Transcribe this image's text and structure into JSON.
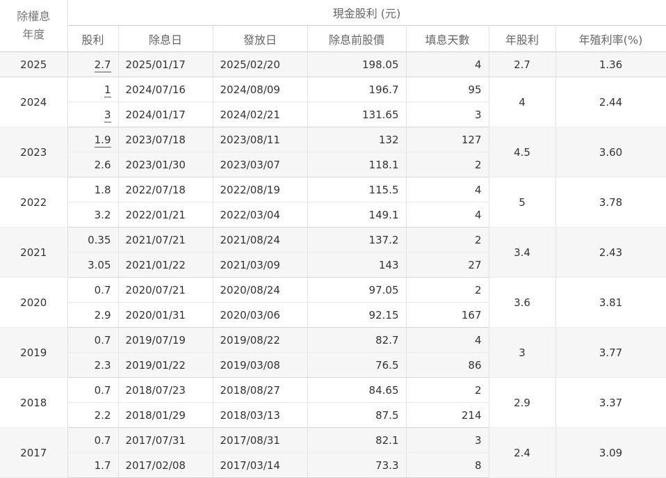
{
  "header": {
    "year_line1": "除權息",
    "year_line2": "年度",
    "group_title": "現金股利 (元)",
    "cols": [
      "股利",
      "除息日",
      "發放日",
      "除息前股價",
      "填息天數",
      "年股利",
      "年殖利率(%)"
    ]
  },
  "years": [
    {
      "year": "2025",
      "annual": "2.7",
      "yield": "1.36",
      "rows": [
        {
          "div": "2.7",
          "underline": true,
          "ex": "2025/01/17",
          "pay": "2025/02/20",
          "price": "198.05",
          "days": "4"
        }
      ]
    },
    {
      "year": "2024",
      "annual": "4",
      "yield": "2.44",
      "rows": [
        {
          "div": "1",
          "underline": true,
          "ex": "2024/07/16",
          "pay": "2024/08/09",
          "price": "196.7",
          "days": "95"
        },
        {
          "div": "3",
          "underline": true,
          "ex": "2024/01/17",
          "pay": "2024/02/21",
          "price": "131.65",
          "days": "3"
        }
      ]
    },
    {
      "year": "2023",
      "annual": "4.5",
      "yield": "3.60",
      "rows": [
        {
          "div": "1.9",
          "underline": true,
          "ex": "2023/07/18",
          "pay": "2023/08/11",
          "price": "132",
          "days": "127"
        },
        {
          "div": "2.6",
          "underline": false,
          "ex": "2023/01/30",
          "pay": "2023/03/07",
          "price": "118.1",
          "days": "2"
        }
      ]
    },
    {
      "year": "2022",
      "annual": "5",
      "yield": "3.78",
      "rows": [
        {
          "div": "1.8",
          "underline": false,
          "ex": "2022/07/18",
          "pay": "2022/08/19",
          "price": "115.5",
          "days": "4"
        },
        {
          "div": "3.2",
          "underline": false,
          "ex": "2022/01/21",
          "pay": "2022/03/04",
          "price": "149.1",
          "days": "4"
        }
      ]
    },
    {
      "year": "2021",
      "annual": "3.4",
      "yield": "2.43",
      "rows": [
        {
          "div": "0.35",
          "underline": false,
          "ex": "2021/07/21",
          "pay": "2021/08/24",
          "price": "137.2",
          "days": "2"
        },
        {
          "div": "3.05",
          "underline": false,
          "ex": "2021/01/22",
          "pay": "2021/03/09",
          "price": "143",
          "days": "27"
        }
      ]
    },
    {
      "year": "2020",
      "annual": "3.6",
      "yield": "3.81",
      "rows": [
        {
          "div": "0.7",
          "underline": false,
          "ex": "2020/07/21",
          "pay": "2020/08/24",
          "price": "97.05",
          "days": "2"
        },
        {
          "div": "2.9",
          "underline": false,
          "ex": "2020/01/31",
          "pay": "2020/03/06",
          "price": "92.15",
          "days": "167"
        }
      ]
    },
    {
      "year": "2019",
      "annual": "3",
      "yield": "3.77",
      "rows": [
        {
          "div": "0.7",
          "underline": false,
          "ex": "2019/07/19",
          "pay": "2019/08/22",
          "price": "82.7",
          "days": "4"
        },
        {
          "div": "2.3",
          "underline": false,
          "ex": "2019/01/22",
          "pay": "2019/03/08",
          "price": "76.5",
          "days": "86"
        }
      ]
    },
    {
      "year": "2018",
      "annual": "2.9",
      "yield": "3.37",
      "rows": [
        {
          "div": "0.7",
          "underline": false,
          "ex": "2018/07/23",
          "pay": "2018/08/27",
          "price": "84.65",
          "days": "2"
        },
        {
          "div": "2.2",
          "underline": false,
          "ex": "2018/01/29",
          "pay": "2018/03/13",
          "price": "87.5",
          "days": "214"
        }
      ]
    },
    {
      "year": "2017",
      "annual": "2.4",
      "yield": "3.09",
      "rows": [
        {
          "div": "0.7",
          "underline": false,
          "ex": "2017/07/31",
          "pay": "2017/08/31",
          "price": "82.1",
          "days": "3"
        },
        {
          "div": "1.7",
          "underline": false,
          "ex": "2017/02/08",
          "pay": "2017/03/14",
          "price": "73.3",
          "days": "8"
        }
      ]
    }
  ]
}
